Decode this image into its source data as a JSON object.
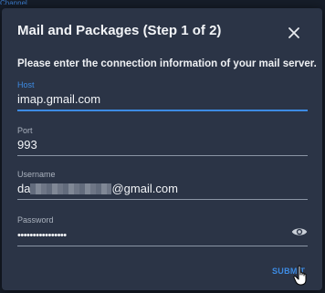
{
  "background": {
    "link_text": "Channels"
  },
  "dialog": {
    "title": "Mail and Packages (Step 1 of 2)",
    "intro": "Please enter the connection information of your mail server.",
    "fields": {
      "host": {
        "label": "Host",
        "value": "imap.gmail.com"
      },
      "port": {
        "label": "Port",
        "value": "993"
      },
      "username": {
        "label": "Username",
        "value_prefix": "da",
        "value_suffix": "@gmail.com"
      },
      "password": {
        "label": "Password",
        "value": "••••••••••••••••"
      }
    },
    "submit_label": "SUBMIT"
  },
  "icons": [
    "close-icon",
    "eye-icon",
    "hand-cursor-icon"
  ],
  "colors": {
    "dialog_bg": "#2b3446",
    "accent": "#3d8be3",
    "page_bg": "#161d29"
  }
}
